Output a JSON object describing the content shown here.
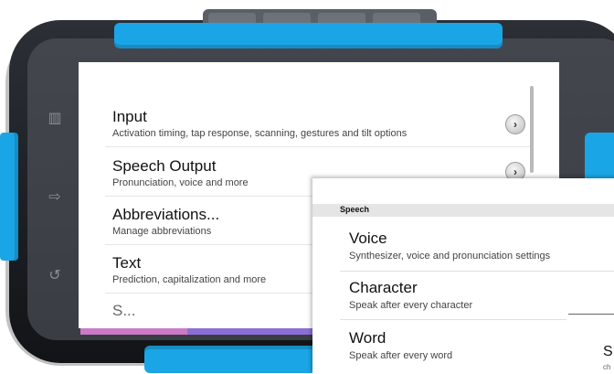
{
  "settings": {
    "items": [
      {
        "title": "Input",
        "subtitle": "Activation timing, tap response, scanning, gestures and tilt options"
      },
      {
        "title": "Speech Output",
        "subtitle": "Pronunciation, voice and more"
      },
      {
        "title": "Abbreviations...",
        "subtitle": "Manage abbreviations"
      },
      {
        "title": "Text",
        "subtitle": "Prediction, capitalization and more"
      }
    ],
    "partial_item": "S..."
  },
  "speech_panel": {
    "header": "Speech",
    "items": [
      {
        "title": "Voice",
        "subtitle": "Synthesizer, voice and pronunciation settings"
      },
      {
        "title": "Character",
        "subtitle": "Speak after every character"
      },
      {
        "title": "Word",
        "subtitle": "Speak after every word"
      }
    ],
    "partial_title": "S",
    "partial_sub": "ch"
  },
  "icons": {
    "chevron": "chevron-right-icon",
    "device_buttons": [
      "menu-icon",
      "back-icon",
      "return-icon"
    ]
  },
  "colors": {
    "case_blue": "#1aa6e6",
    "case_dark": "#1c1f24"
  }
}
